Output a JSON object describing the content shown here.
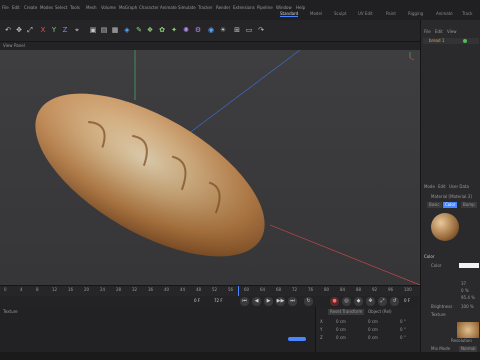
{
  "menu": [
    "File",
    "Edit",
    "Create",
    "Modes",
    "Select",
    "Tools",
    "Mesh",
    "Volume",
    "MoGraph",
    "Character",
    "Animate",
    "Simulate",
    "Tracker",
    "Render",
    "Extensions",
    "Pipeline",
    "Window",
    "Help"
  ],
  "layouts": [
    "Standard",
    "Model",
    "Sculpt",
    "UV Edit",
    "Paint",
    "Rigging",
    "Animate",
    "Track"
  ],
  "viewport_menu": [
    "View",
    "Cameras",
    "Display",
    "Options",
    "Filter",
    "Panel"
  ],
  "object_panel": {
    "menu": [
      "File",
      "Edit",
      "View"
    ],
    "object_name": "bread 1"
  },
  "attributes": {
    "menu": [
      "Mode",
      "Edit",
      "User Data"
    ],
    "material_label": "Material [Material.3]",
    "tabs": [
      "Basic",
      "Color",
      "Bump"
    ],
    "section_title": "Color",
    "color_label": "Color",
    "brightness_label": "Brightness",
    "brightness_value": "100 %",
    "texture_label": "Texture",
    "resolution_label": "Resolution",
    "mix_mode_label": "Mix Mode",
    "mix_mode_value": "Normal",
    "color_values": [
      "37",
      "0 %",
      "95.4 %"
    ]
  },
  "timeline": {
    "ticks": [
      "0",
      "4",
      "8",
      "12",
      "16",
      "20",
      "24",
      "28",
      "32",
      "36",
      "40",
      "44",
      "48",
      "52",
      "56",
      "60",
      "64",
      "68",
      "72",
      "76",
      "80",
      "84",
      "88",
      "92",
      "96",
      "100"
    ],
    "current_frame": "0 F",
    "start_frame": "0 F",
    "end_frame": "72 F",
    "end_display": "0 F"
  },
  "coords": {
    "header": [
      "Position",
      "Size",
      "Rotation"
    ],
    "tabs": [
      "Reset Transform",
      "Object (Rel)"
    ],
    "rows": [
      [
        "X",
        "0 cm",
        "0 cm",
        "0 °"
      ],
      [
        "Y",
        "0 cm",
        "0 cm",
        "0 °"
      ],
      [
        "Z",
        "0 cm",
        "0 cm",
        "0 °"
      ]
    ]
  },
  "bottom_label": "Texture",
  "colors": {
    "accent": "#4a86ff",
    "bread": "#c07a37"
  }
}
